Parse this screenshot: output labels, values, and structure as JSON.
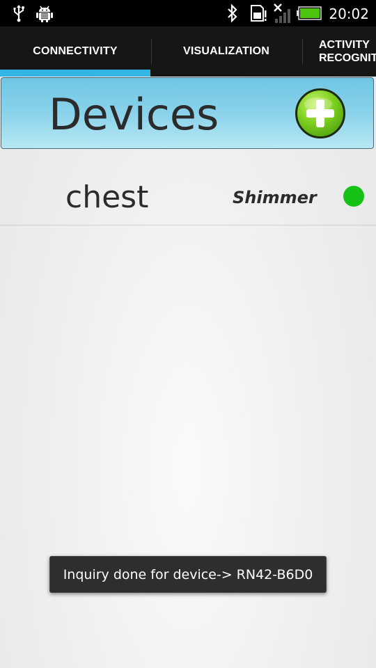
{
  "status_bar": {
    "time": "20:02",
    "icons": [
      "usb-icon",
      "android-debug-icon",
      "bluetooth-icon",
      "sd-card-icon",
      "no-signal-icon",
      "battery-icon"
    ]
  },
  "tabs": [
    {
      "label": "CONNECTIVITY",
      "selected": true
    },
    {
      "label": "VISUALIZATION",
      "selected": false
    },
    {
      "label_line1": "ACTIVITY",
      "label_line2": "RECOGNIT",
      "selected": false
    }
  ],
  "header": {
    "title": "Devices",
    "add_icon": "plus-circle-icon"
  },
  "devices": [
    {
      "name": "chest",
      "type": "Shimmer",
      "status_color": "#16c216"
    }
  ],
  "toast": {
    "message": "Inquiry done for device-> RN42-B6D0"
  },
  "colors": {
    "accent": "#33b5e5",
    "header_gradient_top": "#6fc6e3",
    "header_gradient_bottom": "#b8e8f4",
    "connected": "#16c216"
  }
}
